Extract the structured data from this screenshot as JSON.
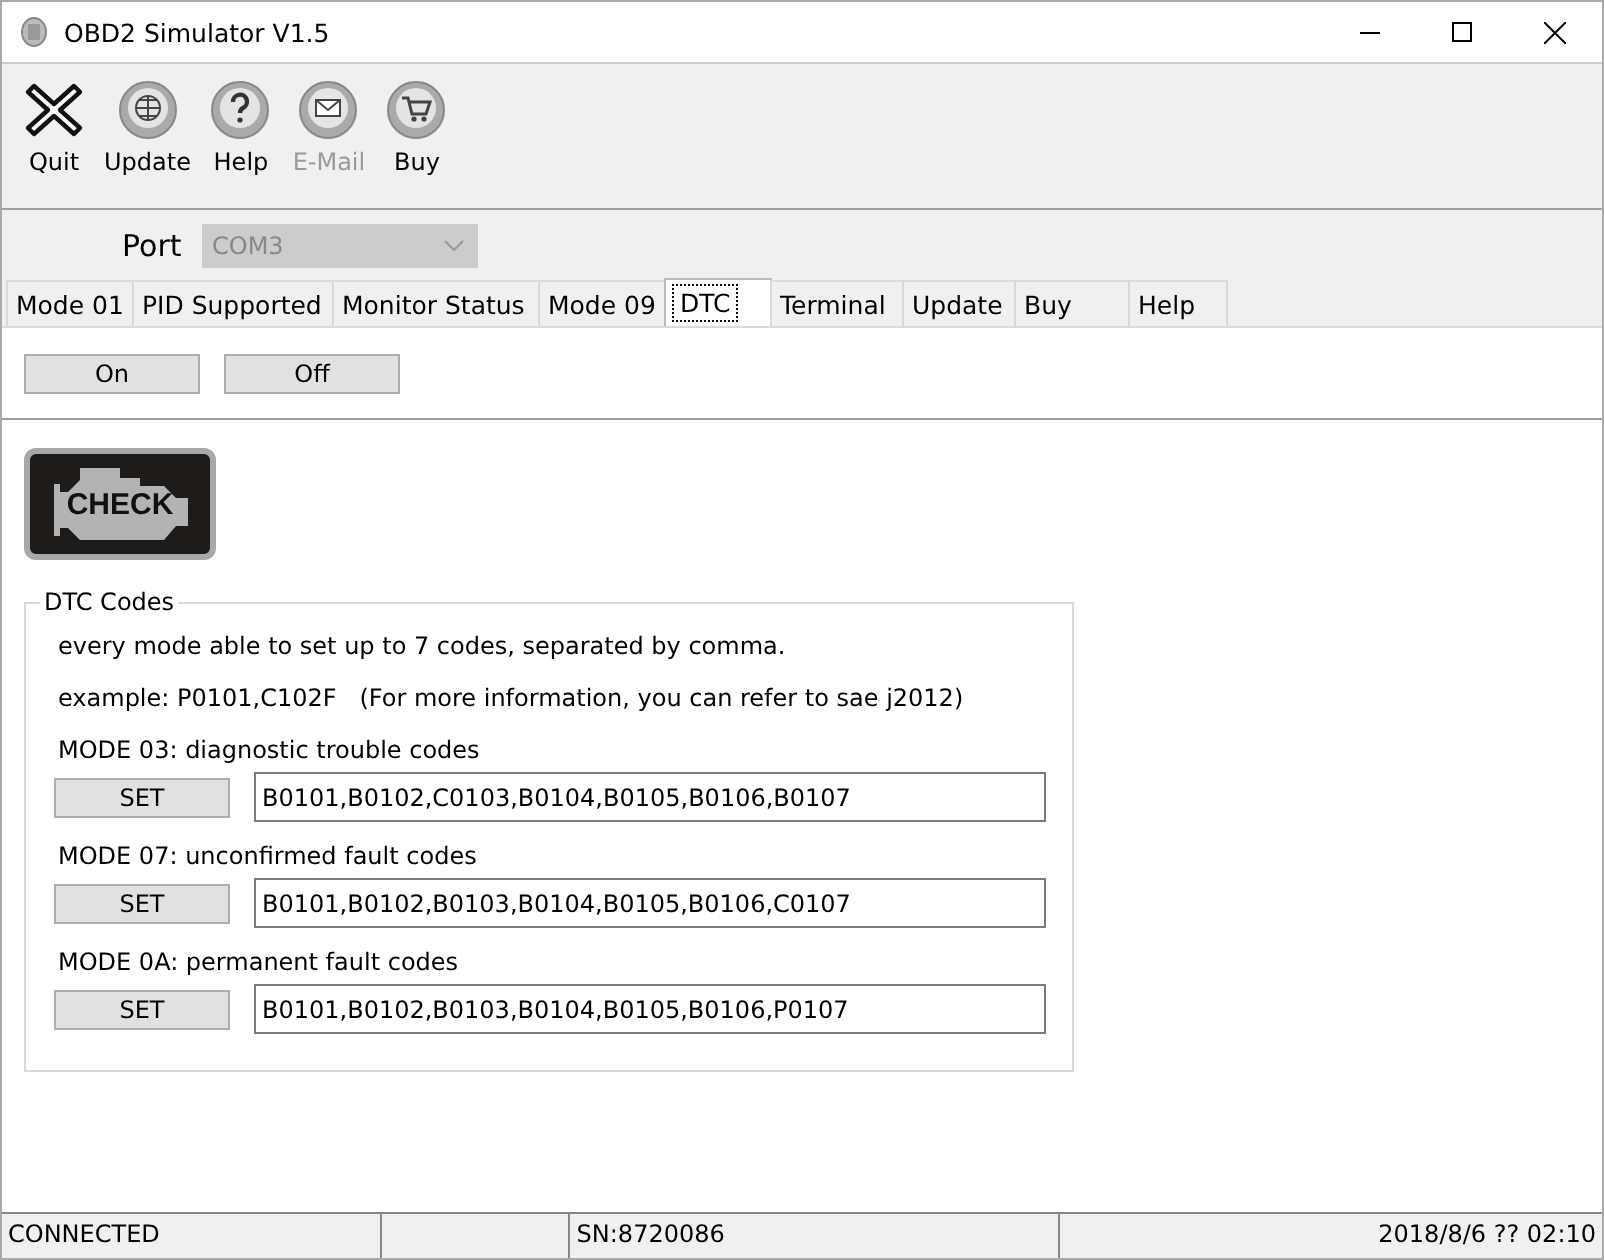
{
  "window": {
    "title": "OBD2 Simulator  V1.5"
  },
  "toolbar": [
    {
      "label": "Quit",
      "kind": "quit",
      "disabled": false
    },
    {
      "label": "Update",
      "kind": "globe",
      "disabled": false
    },
    {
      "label": "Help",
      "kind": "help",
      "disabled": false
    },
    {
      "label": "E-Mail",
      "kind": "mail",
      "disabled": true
    },
    {
      "label": "Buy",
      "kind": "cart",
      "disabled": false
    }
  ],
  "port": {
    "label": "Port",
    "value": "COM3",
    "disabled": true
  },
  "tabs": [
    {
      "label": "Mode 01",
      "selected": false
    },
    {
      "label": "PID Supported",
      "selected": false
    },
    {
      "label": "Monitor Status",
      "selected": false
    },
    {
      "label": "Mode 09",
      "selected": false
    },
    {
      "label": "DTC",
      "selected": true
    },
    {
      "label": "Terminal",
      "selected": false
    },
    {
      "label": "Update",
      "selected": false
    },
    {
      "label": "Buy",
      "selected": false
    },
    {
      "label": "Help",
      "selected": false
    }
  ],
  "switch_buttons": [
    "On",
    "Off"
  ],
  "check_light": {
    "label": "CHECK"
  },
  "dtc_codes": {
    "title": "DTC Codes",
    "notes": [
      "every mode able to set up to 7 codes, separated by comma.",
      "example: P0101,C102F   (For more information, you can refer to sae j2012)"
    ],
    "modes": [
      {
        "label": "MODE 03: diagnostic trouble codes",
        "button": "SET",
        "value": "B0101,B0102,C0103,B0104,B0105,B0106,B0107"
      },
      {
        "label": "MODE 07: unconfirmed fault codes",
        "button": "SET",
        "value": "B0101,B0102,B0103,B0104,B0105,B0106,C0107"
      },
      {
        "label": "MODE 0A: permanent fault codes",
        "button": "SET",
        "value": "B0101,B0102,B0103,B0104,B0105,B0106,P0107"
      }
    ]
  },
  "status_bar": [
    "CONNECTED",
    "SN:8720086",
    "2018/8/6 ?? 02:10"
  ]
}
